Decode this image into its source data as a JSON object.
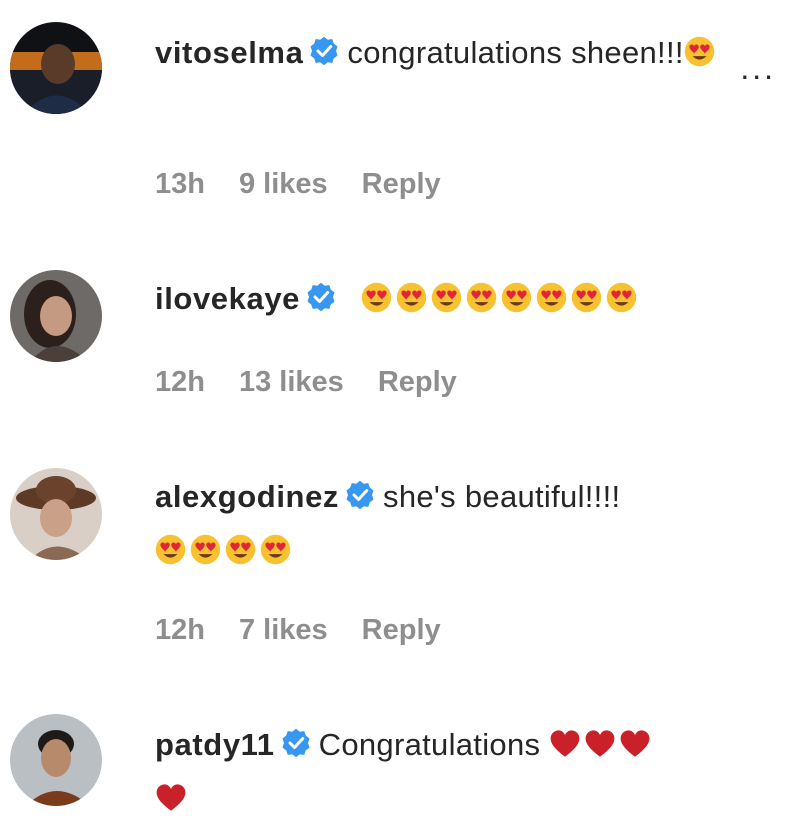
{
  "comments": [
    {
      "username": "vitoselma",
      "verified": true,
      "text": "congratulations sheen!!!",
      "emojis": [
        "heart-eyes"
      ],
      "time": "13h",
      "likes": "9 likes",
      "reply": "Reply",
      "more": "..."
    },
    {
      "username": "ilovekaye",
      "verified": true,
      "text": "",
      "emojis": [
        "heart-eyes",
        "heart-eyes",
        "heart-eyes",
        "heart-eyes",
        "heart-eyes",
        "heart-eyes",
        "heart-eyes",
        "heart-eyes"
      ],
      "time": "12h",
      "likes": "13 likes",
      "reply": "Reply"
    },
    {
      "username": "alexgodinez",
      "verified": true,
      "text": "she's beautiful!!!!",
      "emojis": [
        "heart-eyes",
        "heart-eyes",
        "heart-eyes",
        "heart-eyes"
      ],
      "time": "12h",
      "likes": "7 likes",
      "reply": "Reply"
    },
    {
      "username": "patdy11",
      "verified": true,
      "text": "Congratulations",
      "emojis": [
        "red-heart",
        "red-heart",
        "red-heart",
        "red-heart"
      ]
    }
  ],
  "colors": {
    "verified_blue": "#3897f0",
    "meta_gray": "#8e8e8e",
    "emoji_yellow": "#f7c12f",
    "heart_red": "#c9202a"
  }
}
